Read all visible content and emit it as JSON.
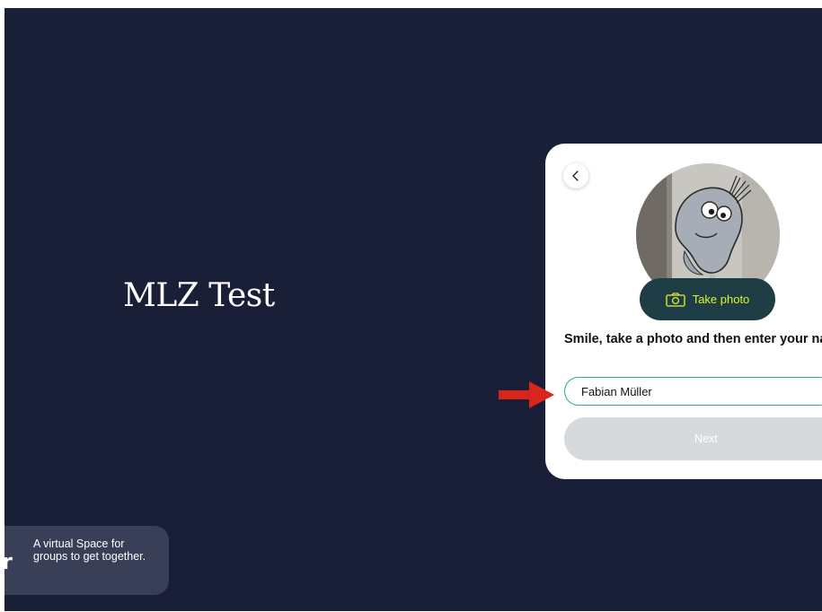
{
  "space": {
    "title": "MLZ Test"
  },
  "promo": {
    "logo_glyph": "r",
    "text": "A virtual Space for groups to get together."
  },
  "card": {
    "back_icon": "chevron-left-icon",
    "photo_button_label": "Take photo",
    "photo_button_icon": "camera-icon",
    "prompt": "Smile, take a photo and then enter your name.",
    "name_value": "Fabian Müller",
    "next_label": "Next"
  },
  "colors": {
    "background": "#1a1f38",
    "photo_button_bg": "#1e3d45",
    "photo_button_text": "#e3f32d",
    "input_border": "#2aa89a",
    "next_disabled": "#d7dadd",
    "annotation_arrow": "#d9251c"
  }
}
